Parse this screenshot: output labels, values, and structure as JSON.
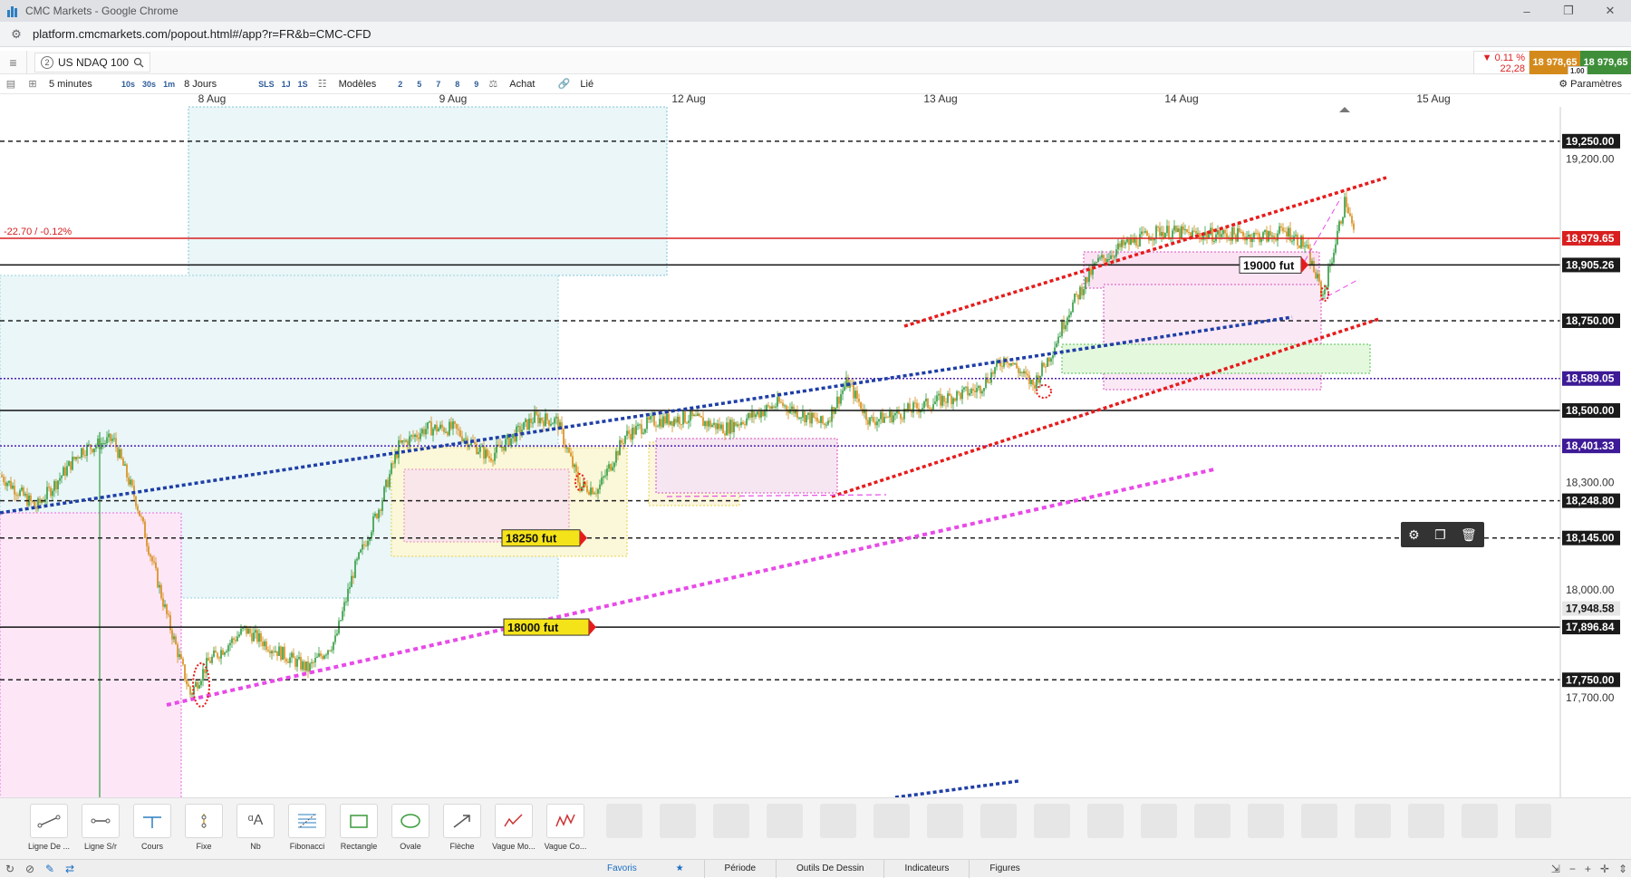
{
  "window": {
    "title": "CMC Markets - Google Chrome",
    "buttons": [
      "–",
      "❐",
      "✕"
    ]
  },
  "address": {
    "url": "platform.cmcmarkets.com/popout.html#/app?r=FR&b=CMC-CFD"
  },
  "instrument": {
    "badge": "2",
    "name": "US NDAQ 100"
  },
  "price": {
    "change_pct": "▼ 0.11 %",
    "change_pts": "22,28",
    "sell": "18 978,65",
    "buy": "18 979,65",
    "spread": "1.00"
  },
  "toolbar": {
    "timeframe": "5 minutes",
    "range": "8 Jours",
    "quick_intervals": [
      "10s",
      "30s",
      "1m"
    ],
    "sls": [
      "SLS",
      "1J",
      "1S"
    ],
    "models_label": "Modèles",
    "model_numbers": [
      "2",
      "5",
      "7",
      "8",
      "9"
    ],
    "buy_label": "Achat",
    "link_label": "Lié",
    "settings_label": "Paramètres"
  },
  "chart_data": {
    "type": "candlestick",
    "instrument": "US NDAQ 100",
    "interval": "5 minutes",
    "x_ticks": [
      "8 Aug",
      "9 Aug",
      "12 Aug",
      "13 Aug",
      "14 Aug",
      "15 Aug"
    ],
    "y_ticks": [
      "19,200.00",
      "18,300.00",
      "18,000.00",
      "17,700.00"
    ],
    "ylim": [
      17650,
      19380
    ],
    "price_levels": [
      {
        "label": "19,250.00",
        "value": 19250,
        "style": "dashed",
        "color": "#222222"
      },
      {
        "label": "18,979.65",
        "value": 18979.65,
        "style": "solid",
        "color": "#d81e1e",
        "current": true
      },
      {
        "label": "18,905.26",
        "value": 18905.26,
        "style": "solid",
        "color": "#111111"
      },
      {
        "label": "18,750.00",
        "value": 18750,
        "style": "dashed",
        "color": "#222222"
      },
      {
        "label": "18,589.05",
        "value": 18589.05,
        "style": "dotted",
        "color": "#4b1fb0"
      },
      {
        "label": "18,500.00",
        "value": 18500,
        "style": "solid",
        "color": "#111111"
      },
      {
        "label": "18,401.33",
        "value": 18401.33,
        "style": "dotted",
        "color": "#4b1fb0"
      },
      {
        "label": "18,248.80",
        "value": 18248.8,
        "style": "dashed",
        "color": "#222222"
      },
      {
        "label": "18,145.00",
        "value": 18145,
        "style": "dashed",
        "color": "#222222"
      },
      {
        "label": "17,948.58",
        "value": 17948.58,
        "style": "none",
        "color": "#e0e0e0"
      },
      {
        "label": "17,896.84",
        "value": 17896.84,
        "style": "solid",
        "color": "#111111"
      },
      {
        "label": "17,750.00",
        "value": 17750,
        "style": "dashed",
        "color": "#222222"
      }
    ],
    "annotations": [
      "19000 fut",
      "18250 fut",
      "18000 fut"
    ],
    "change_label": "-22.70 / -0.12%"
  },
  "drawing_tools": [
    "Ligne De ...",
    "Ligne S/r",
    "Cours",
    "Fixe",
    "Nb",
    "Fibonacci",
    "Rectangle",
    "Ovale",
    "Flèche",
    "Vague Mo...",
    "Vague Co..."
  ],
  "status_tabs": [
    "Favoris",
    "Période",
    "Outils De Dessin",
    "Indicateurs",
    "Figures"
  ]
}
